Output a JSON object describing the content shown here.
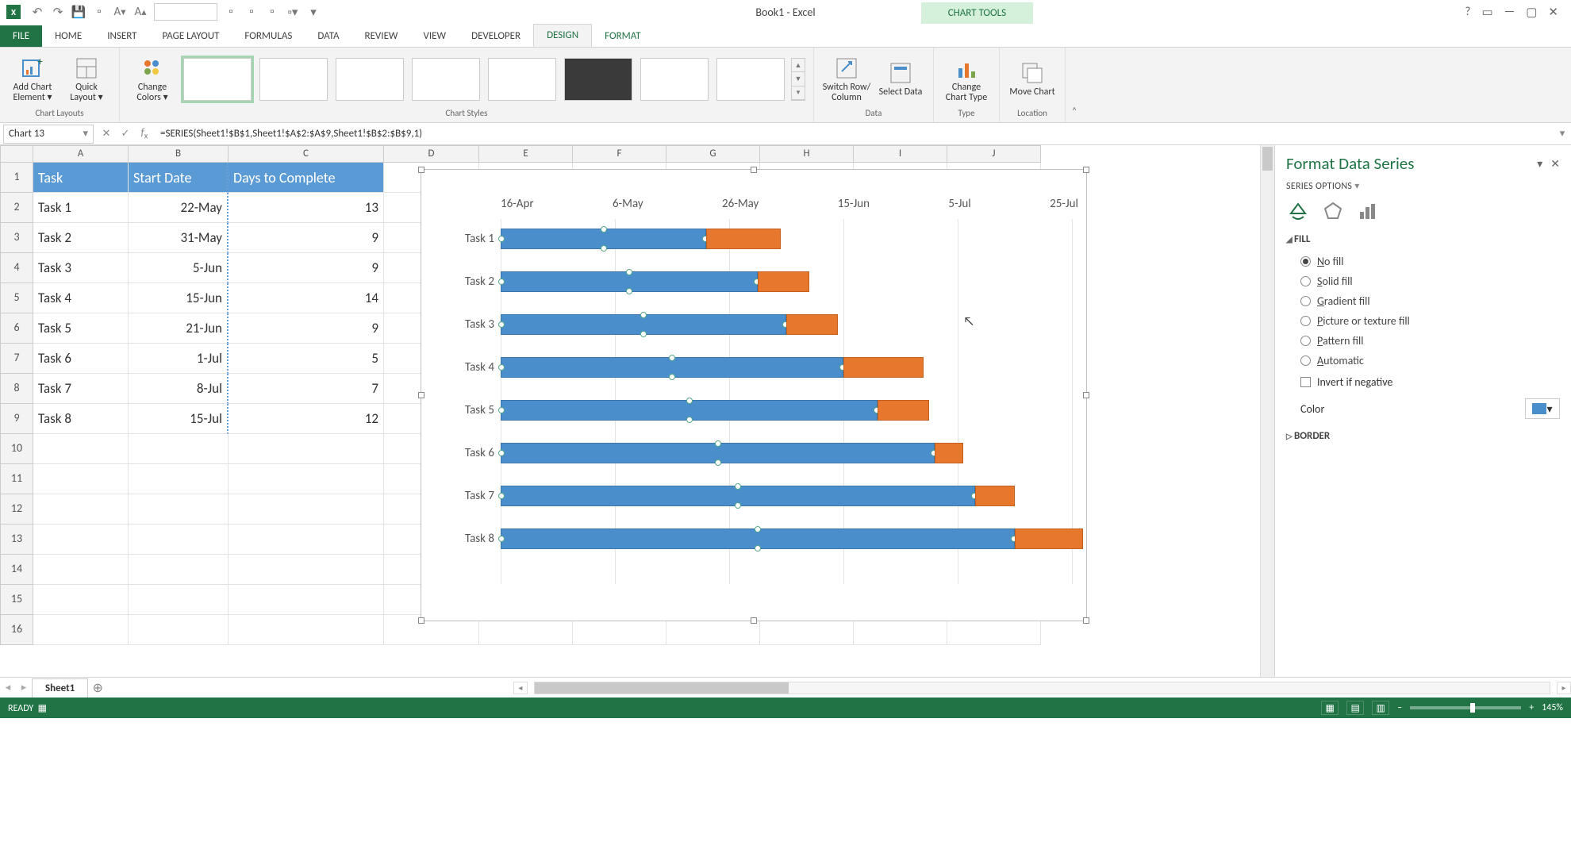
{
  "title": "Book1 - Excel",
  "chart_tools_label": "CHART TOOLS",
  "tabs": [
    "FILE",
    "HOME",
    "INSERT",
    "PAGE LAYOUT",
    "FORMULAS",
    "DATA",
    "REVIEW",
    "VIEW",
    "DEVELOPER",
    "DESIGN",
    "FORMAT"
  ],
  "ribbon": {
    "add_chart_element": "Add Chart Element ▾",
    "quick_layout": "Quick Layout ▾",
    "change_colors": "Change Colors ▾",
    "switch_row_col": "Switch Row/ Column",
    "select_data": "Select Data",
    "change_chart_type": "Change Chart Type",
    "move_chart": "Move Chart",
    "grp_chart_layouts": "Chart Layouts",
    "grp_chart_styles": "Chart Styles",
    "grp_data": "Data",
    "grp_type": "Type",
    "grp_location": "Location"
  },
  "namebox": "Chart 13",
  "formula": "=SERIES(Sheet1!$B$1,Sheet1!$A$2:$A$9,Sheet1!$B$2:$B$9,1)",
  "columns": [
    "A",
    "B",
    "C",
    "D",
    "E",
    "F",
    "G",
    "H",
    "I",
    "J"
  ],
  "table": {
    "headers": [
      "Task",
      "Start Date",
      "Days to Complete"
    ],
    "rows": [
      [
        "Task 1",
        "22-May",
        "13"
      ],
      [
        "Task 2",
        "31-May",
        "9"
      ],
      [
        "Task 3",
        "5-Jun",
        "9"
      ],
      [
        "Task 4",
        "15-Jun",
        "14"
      ],
      [
        "Task 5",
        "21-Jun",
        "9"
      ],
      [
        "Task 6",
        "1-Jul",
        "5"
      ],
      [
        "Task 7",
        "8-Jul",
        "7"
      ],
      [
        "Task 8",
        "15-Jul",
        "12"
      ]
    ]
  },
  "chart_data": {
    "type": "bar",
    "title": "",
    "xlabel": "",
    "ylabel": "",
    "x_ticks": [
      "16-Apr",
      "6-May",
      "26-May",
      "15-Jun",
      "5-Jul",
      "25-Jul"
    ],
    "categories": [
      "Task 1",
      "Task 2",
      "Task 3",
      "Task 4",
      "Task 5",
      "Task 6",
      "Task 7",
      "Task 8"
    ],
    "series": [
      {
        "name": "Start Date",
        "values_label": [
          "22-May",
          "31-May",
          "5-Jun",
          "15-Jun",
          "21-Jun",
          "1-Jul",
          "8-Jul",
          "15-Jul"
        ],
        "values_serial": [
          36,
          45,
          50,
          60,
          66,
          76,
          83,
          90
        ]
      },
      {
        "name": "Days to Complete",
        "values": [
          13,
          9,
          9,
          14,
          9,
          5,
          7,
          12
        ]
      }
    ],
    "x_range_serial": [
      0,
      100
    ],
    "note": "values_serial are day-offsets from 16-Apr (=0) used to position the stacked bars"
  },
  "pane": {
    "title": "Format Data Series",
    "series_options": "SERIES OPTIONS",
    "fill": "FILL",
    "fill_options": [
      "No fill",
      "Solid fill",
      "Gradient fill",
      "Picture or texture fill",
      "Pattern fill",
      "Automatic"
    ],
    "fill_selected": "No fill",
    "invert": "Invert if negative",
    "color_label": "Color",
    "border": "BORDER"
  },
  "sheet_tab": "Sheet1",
  "status_ready": "READY",
  "zoom": "145%"
}
